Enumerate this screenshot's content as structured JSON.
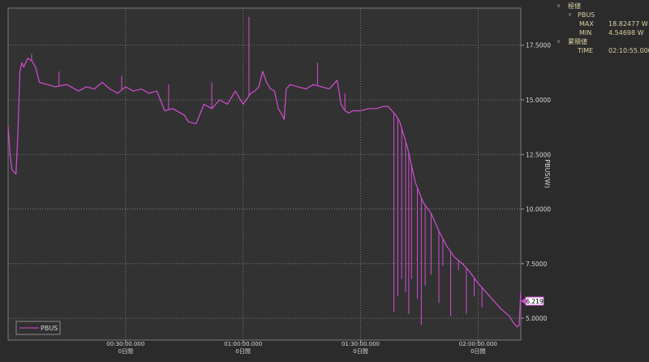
{
  "tree": {
    "group1_label": "極値",
    "series_label": "PBUS",
    "max_label": "MAX",
    "max_value": "18.82477 W",
    "min_label": "MIN",
    "min_value": "4.54698 W",
    "group2_label": "累積値",
    "time_label": "TIME",
    "time_value": "02:10:55.000"
  },
  "cursor_value": "6.219",
  "colors": {
    "background": "#2b2b2b",
    "plot_area": "#323232",
    "series": "#d44cd4",
    "grid": "#8a8a8a"
  },
  "chart_data": {
    "type": "line",
    "x_unit": "time (h:mm:ss)",
    "x_range": [
      "0:00:00",
      "2:10:55"
    ],
    "x_ticks": [
      {
        "time": "0:30:00",
        "label1": "00:30:00.000",
        "label2": "0日間"
      },
      {
        "time": "1:00:00",
        "label1": "01:00:00.000",
        "label2": "0日間"
      },
      {
        "time": "1:30:00",
        "label1": "01:30:00.000",
        "label2": "0日間"
      },
      {
        "time": "2:00:00",
        "label1": "02:00:00.000",
        "label2": "0日間"
      }
    ],
    "ylabel": "PBUS(W)",
    "ylim": [
      4.0,
      19.2
    ],
    "y_ticks": [
      "5.0000",
      "7.5000",
      "10.0000",
      "12.5000",
      "15.0000",
      "17.5000"
    ],
    "grid": true,
    "legend": {
      "position": "bottom-left",
      "entries": [
        "PBUS"
      ]
    },
    "series": [
      {
        "name": "PBUS",
        "points_min_w": [
          [
            0.0,
            13.8
          ],
          [
            0.5,
            12.5
          ],
          [
            1.0,
            11.8
          ],
          [
            2.0,
            11.6
          ],
          [
            2.5,
            13.5
          ],
          [
            3.0,
            16.3
          ],
          [
            3.5,
            16.7
          ],
          [
            4.0,
            16.5
          ],
          [
            5.0,
            16.9
          ],
          [
            6.0,
            16.8
          ],
          [
            7.0,
            16.5
          ],
          [
            8.0,
            15.8
          ],
          [
            10.0,
            15.7
          ],
          [
            12.0,
            15.6
          ],
          [
            15.0,
            15.7
          ],
          [
            18.0,
            15.4
          ],
          [
            20.0,
            15.6
          ],
          [
            22.0,
            15.5
          ],
          [
            24.0,
            15.8
          ],
          [
            26.0,
            15.5
          ],
          [
            28.0,
            15.3
          ],
          [
            30.0,
            15.6
          ],
          [
            32.0,
            15.4
          ],
          [
            34.0,
            15.5
          ],
          [
            36.0,
            15.3
          ],
          [
            38.0,
            15.4
          ],
          [
            40.0,
            14.5
          ],
          [
            42.0,
            14.6
          ],
          [
            44.0,
            14.4
          ],
          [
            45.0,
            14.3
          ],
          [
            46.0,
            14.0
          ],
          [
            48.0,
            13.9
          ],
          [
            50.0,
            14.8
          ],
          [
            52.0,
            14.6
          ],
          [
            54.0,
            15.0
          ],
          [
            56.0,
            14.8
          ],
          [
            58.0,
            15.4
          ],
          [
            60.0,
            14.8
          ],
          [
            62.0,
            15.3
          ],
          [
            63.0,
            15.4
          ],
          [
            64.0,
            15.6
          ],
          [
            65.0,
            16.3
          ],
          [
            66.0,
            15.8
          ],
          [
            67.0,
            15.5
          ],
          [
            68.0,
            15.4
          ],
          [
            69.0,
            14.6
          ],
          [
            70.0,
            14.3
          ],
          [
            70.5,
            14.1
          ],
          [
            71.0,
            15.5
          ],
          [
            72.0,
            15.7
          ],
          [
            74.0,
            15.6
          ],
          [
            76.0,
            15.5
          ],
          [
            78.0,
            15.7
          ],
          [
            80.0,
            15.6
          ],
          [
            82.0,
            15.5
          ],
          [
            84.0,
            15.9
          ],
          [
            84.5,
            15.4
          ],
          [
            85.0,
            14.8
          ],
          [
            86.0,
            14.5
          ],
          [
            87.0,
            14.4
          ],
          [
            88.0,
            14.5
          ],
          [
            90.0,
            14.5
          ],
          [
            92.0,
            14.6
          ],
          [
            94.0,
            14.6
          ],
          [
            96.0,
            14.7
          ],
          [
            97.0,
            14.7
          ],
          [
            98.0,
            14.5
          ],
          [
            99.0,
            14.3
          ],
          [
            100.0,
            14.0
          ],
          [
            101.0,
            13.4
          ],
          [
            102.0,
            12.8
          ],
          [
            104.0,
            11.2
          ],
          [
            106.0,
            10.3
          ],
          [
            108.0,
            9.8
          ],
          [
            110.0,
            9.0
          ],
          [
            112.0,
            8.3
          ],
          [
            114.0,
            7.8
          ],
          [
            116.0,
            7.5
          ],
          [
            118.0,
            7.1
          ],
          [
            120.0,
            6.6
          ],
          [
            122.0,
            6.2
          ],
          [
            124.0,
            5.8
          ],
          [
            126.0,
            5.4
          ],
          [
            128.0,
            5.1
          ],
          [
            129.0,
            4.8
          ],
          [
            130.0,
            4.6
          ],
          [
            130.5,
            4.7
          ],
          [
            130.9,
            6.2
          ]
        ],
        "spikes_min_w": [
          [
            6.0,
            17.1
          ],
          [
            13.0,
            16.3
          ],
          [
            29.0,
            16.1
          ],
          [
            41.0,
            15.7
          ],
          [
            52.0,
            15.8
          ],
          [
            61.5,
            18.8
          ],
          [
            79.0,
            16.7
          ],
          [
            86.0,
            15.3
          ],
          [
            98.5,
            5.3
          ],
          [
            99.5,
            6.0
          ],
          [
            100.5,
            6.8
          ],
          [
            101.5,
            6.2
          ],
          [
            102.3,
            5.2
          ],
          [
            103.0,
            6.8
          ],
          [
            104.5,
            5.9
          ],
          [
            105.5,
            4.7
          ],
          [
            106.5,
            6.5
          ],
          [
            108.0,
            7.0
          ],
          [
            110.0,
            5.7
          ],
          [
            111.0,
            7.4
          ],
          [
            113.0,
            5.1
          ],
          [
            115.0,
            7.2
          ],
          [
            117.0,
            5.2
          ],
          [
            119.0,
            6.0
          ],
          [
            121.0,
            5.5
          ]
        ]
      }
    ]
  }
}
